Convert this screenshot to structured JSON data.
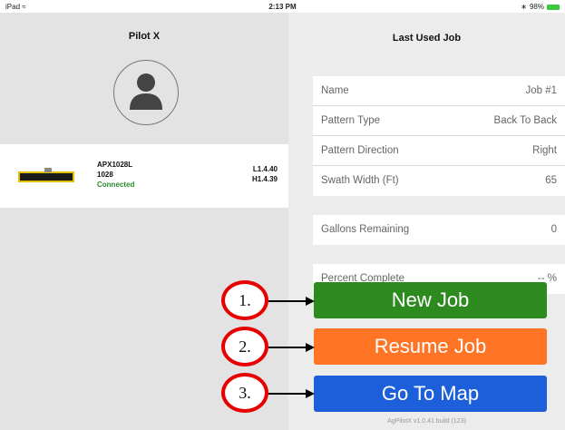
{
  "status_bar": {
    "device": "iPad",
    "time": "2:13 PM",
    "battery": "98%"
  },
  "left_panel": {
    "title": "Pilot X",
    "device": {
      "name": "APX1028L",
      "serial": "1028",
      "status": "Connected",
      "version_l": "L1.4.40",
      "version_h": "H1.4.39"
    }
  },
  "right_panel": {
    "title": "Last Used Job",
    "job_info": [
      {
        "label": "Name",
        "value": "Job #1"
      },
      {
        "label": "Pattern Type",
        "value": "Back To Back"
      },
      {
        "label": "Pattern Direction",
        "value": "Right"
      },
      {
        "label": "Swath Width (Ft)",
        "value": "65"
      }
    ],
    "gallons": {
      "label": "Gallons Remaining",
      "value": "0"
    },
    "percent": {
      "label": "Percent Complete",
      "value": "-- %"
    },
    "buttons": {
      "new_job": "New Job",
      "resume_job": "Resume Job",
      "go_to_map": "Go To Map"
    },
    "build": "AgPilotX v1.0.41 build (123)"
  },
  "callouts": [
    "1.",
    "2.",
    "3."
  ],
  "colors": {
    "new_job": "#2c8a1e",
    "resume_job": "#ff7425",
    "go_to_map": "#1d5fdb",
    "callout_ring": "#e60000",
    "connected": "#2a8a2a"
  }
}
